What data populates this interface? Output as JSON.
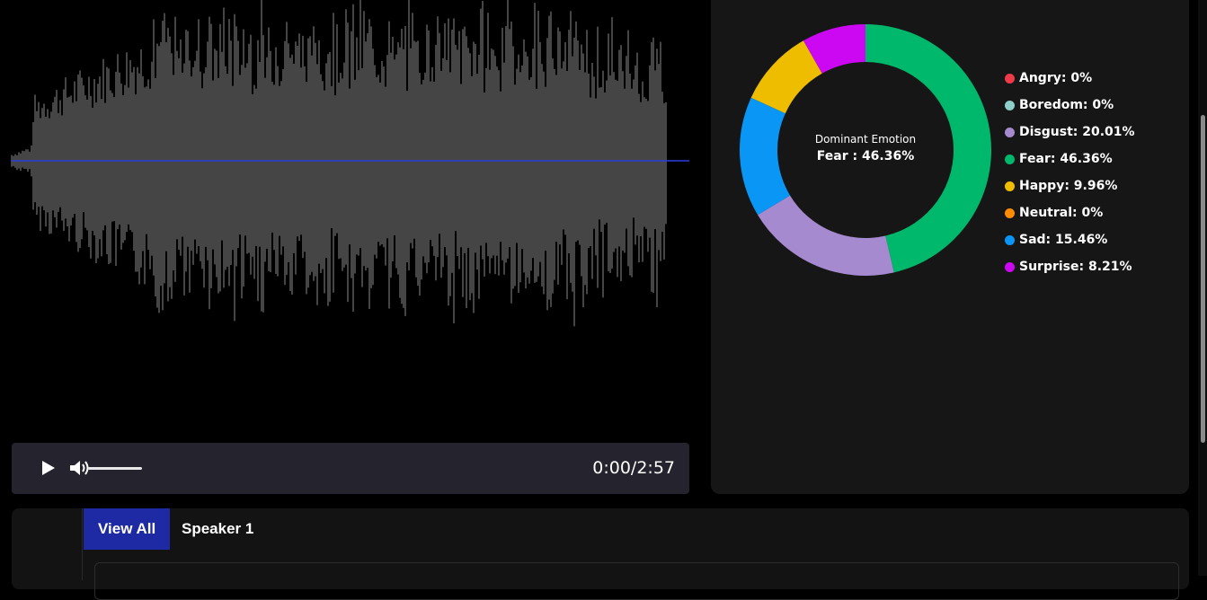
{
  "player": {
    "play_icon": "play-icon",
    "volume_icon": "volume-icon",
    "volume_level": 1.0,
    "current_time": "0:00",
    "duration": "2:57",
    "time_display": "0:00/2:57"
  },
  "waveform": {
    "wave_color": "#8a8a8a",
    "progress_line_color": "#2b3fe0"
  },
  "emotion": {
    "center_title": "Dominant Emotion",
    "center_value": "Fear : 46.36%"
  },
  "chart_data": {
    "type": "pie",
    "categories": [
      "Angry",
      "Boredom",
      "Disgust",
      "Fear",
      "Happy",
      "Neutral",
      "Sad",
      "Surprise"
    ],
    "values": [
      0,
      0,
      20.01,
      46.36,
      9.96,
      0,
      15.46,
      8.21
    ],
    "colors": [
      "#ef3a4a",
      "#8ecfc9",
      "#a68ad0",
      "#00b86b",
      "#eebd00",
      "#ff8c00",
      "#0a96f5",
      "#cc08f2"
    ],
    "legend_labels": [
      "Angry: 0%",
      "Boredom: 0%",
      "Disgust: 20.01%",
      "Fear: 46.36%",
      "Happy: 9.96%",
      "Neutral: 0%",
      "Sad: 15.46%",
      "Surprise: 8.21%"
    ],
    "legend_position": "right",
    "donut": true
  },
  "tabs": {
    "items": [
      {
        "label": "View All",
        "active": true
      },
      {
        "label": "Speaker 1",
        "active": false
      }
    ]
  }
}
